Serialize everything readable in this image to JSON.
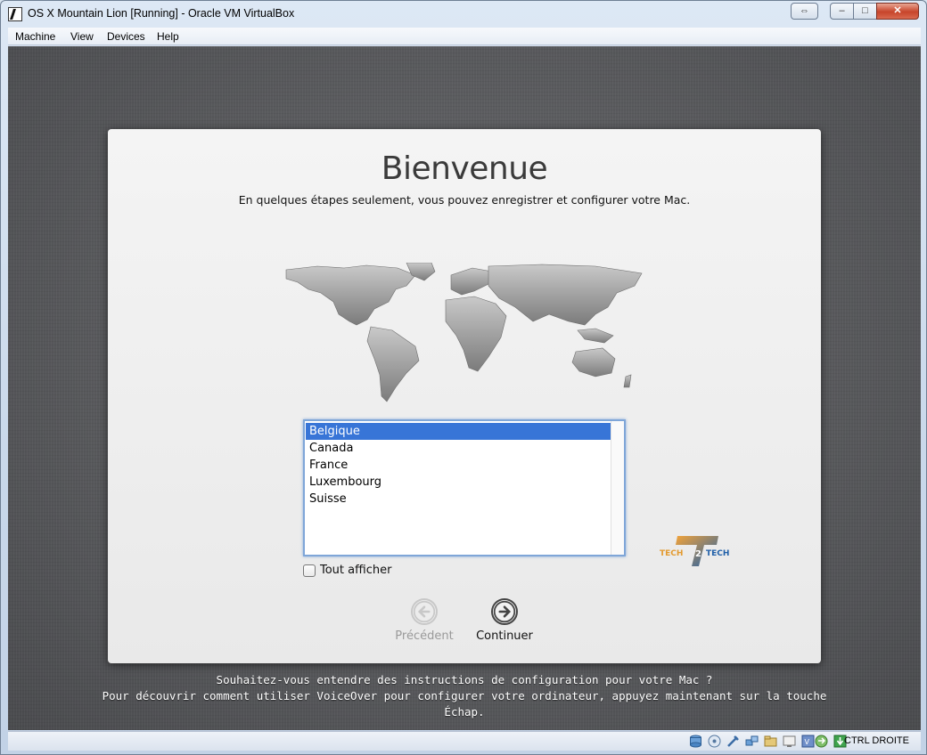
{
  "window": {
    "title": "OS X Mountain Lion [Running] - Oracle VM VirtualBox",
    "controls": {
      "switch": "⇔",
      "minimize": "–",
      "maximize": "□",
      "close": "✕"
    }
  },
  "menubar": {
    "items": [
      "Machine",
      "View",
      "Devices",
      "Help"
    ]
  },
  "setup": {
    "title": "Bienvenue",
    "subtitle": "En quelques étapes seulement, vous pouvez enregistrer et configurer votre Mac.",
    "countries": [
      "Belgique",
      "Canada",
      "France",
      "Luxembourg",
      "Suisse"
    ],
    "selected_country": "Belgique",
    "show_all": {
      "label": "Tout afficher",
      "checked": false
    },
    "prev_label": "Précédent",
    "next_label": "Continuer",
    "logo": {
      "left": "TECH",
      "number": "2",
      "right": "TECH"
    }
  },
  "voiceover": {
    "line1": "Souhaitez-vous entendre des instructions de configuration pour votre Mac ?",
    "line2": "Pour découvrir comment utiliser VoiceOver pour configurer votre ordinateur, appuyez maintenant sur la touche",
    "line3": "Échap."
  },
  "statusbar": {
    "icons": [
      "hard-disk-icon",
      "optical-drive-icon",
      "usb-icon",
      "network-icon",
      "shared-folder-icon",
      "display-icon",
      "video-capture-icon",
      "mouse-integration-icon",
      "host-key-icon"
    ],
    "host_key_label": "CTRL DROITE"
  },
  "colors": {
    "selection": "#3875d7",
    "close_button": "#c7442a",
    "desktop": "#5a5b5e"
  }
}
